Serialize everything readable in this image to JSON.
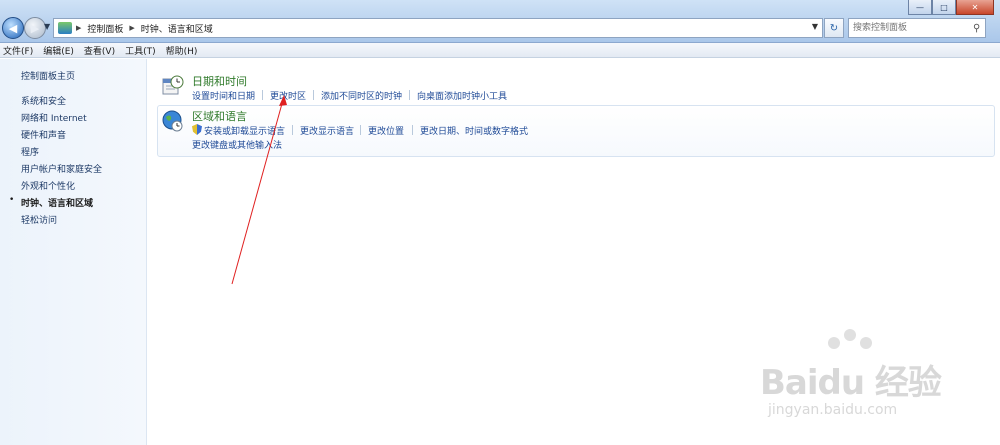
{
  "window": {
    "minimize_glyph": "—",
    "maximize_glyph": "□",
    "close_glyph": "✕"
  },
  "address_bar": {
    "crumbs": [
      "控制面板",
      "时钟、语言和区域"
    ],
    "separator": "▶"
  },
  "search": {
    "placeholder": "搜索控制面板"
  },
  "menubar": {
    "items": [
      "文件(F)",
      "编辑(E)",
      "查看(V)",
      "工具(T)",
      "帮助(H)"
    ]
  },
  "sidebar": {
    "items": [
      {
        "label": "控制面板主页"
      },
      {
        "label": "系统和安全"
      },
      {
        "label": "网络和 Internet"
      },
      {
        "label": "硬件和声音"
      },
      {
        "label": "程序"
      },
      {
        "label": "用户帐户和家庭安全"
      },
      {
        "label": "外观和个性化"
      },
      {
        "label": "时钟、语言和区域",
        "current": true
      },
      {
        "label": "轻松访问"
      }
    ],
    "bullet": "•"
  },
  "sections": [
    {
      "title": "日期和时间",
      "icon": "calendar-clock-icon",
      "tasks": [
        "设置时间和日期",
        "更改时区",
        "添加不同时区的时钟",
        "向桌面添加时钟小工具"
      ]
    },
    {
      "title": "区域和语言",
      "icon": "globe-clock-icon",
      "tasks": [
        "安装或卸载显示语言",
        "更改显示语言",
        "更改位置",
        "更改日期、时间或数字格式",
        "更改键盘或其他输入法"
      ]
    }
  ],
  "watermark": {
    "logo": "Baidu 经验",
    "url": "jingyan.baidu.com"
  },
  "colors": {
    "link": "#1f4a97",
    "section_title": "#2f7a2a",
    "annotation_arrow": "#e02020"
  }
}
